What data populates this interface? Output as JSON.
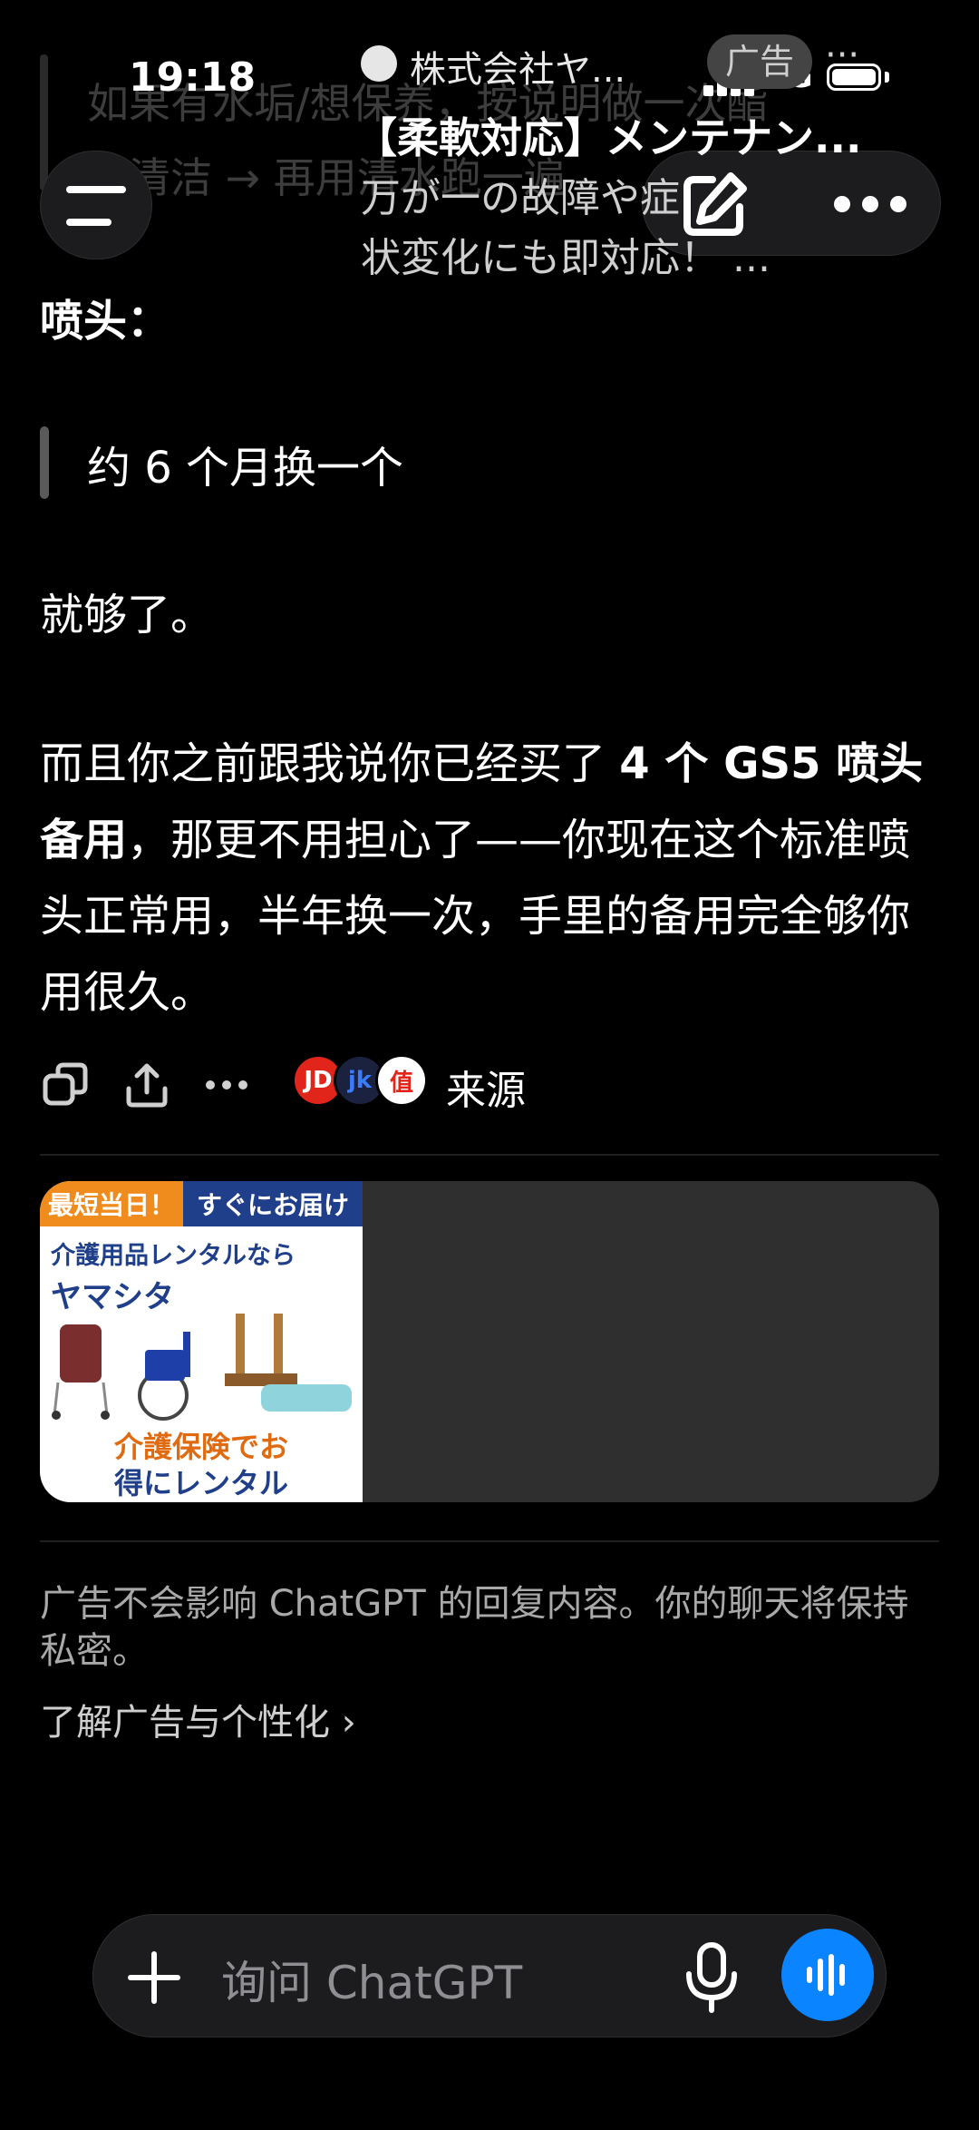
{
  "status_bar": {
    "time": "19:18",
    "network": "5G"
  },
  "previous_text": {
    "line1": "如果有水垢/想保养，按说明做一次酯",
    "line2": "类清洁 → 再用清水跑一遍"
  },
  "message": {
    "heading": "喷头：",
    "quote": "约 6 个月换一个",
    "line_enough": "就够了。",
    "para_intro": "而且你之前跟我说你已经买了",
    "para_bold": "4 个 GS5 喷头备用",
    "para_rest": "，那更不用担心了——你现在这个标准喷头正常用，半年换一次，手里的备用完全够你用很久。"
  },
  "actions": {
    "source_label": "来源",
    "source_logos": [
      "JD",
      "jk",
      "值"
    ],
    "copy_icon": "copy-icon",
    "share_icon": "share-icon",
    "more_icon": "more-icon"
  },
  "ad": {
    "image": {
      "banner_left": "最短当日！",
      "banner_right": "すぐにお届け",
      "subtitle": "介護用品レンタルなら",
      "brand": "ヤマシタ",
      "insurance_line1": "介護保険でお",
      "insurance_line2": "得にレンタル"
    },
    "source": "株式会社ヤ...",
    "tag": "广告",
    "title": "【柔軟対応】メンテナン...",
    "desc_line1": "万が一の故障や症",
    "desc_line2": "状変化にも即対応！ ..."
  },
  "ad_note": "广告不会影响 ChatGPT 的回复内容。你的聊天将保持私密。",
  "learn_more": "了解广告与个性化 ›",
  "composer": {
    "placeholder": "询问 ChatGPT"
  },
  "colors": {
    "background": "#000000",
    "accent": "#0a84ff",
    "card": "#2f2f2f"
  }
}
